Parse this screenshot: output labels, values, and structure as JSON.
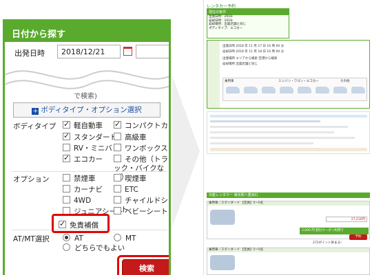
{
  "left_panel": {
    "header": "日付から探す",
    "date_label": "出発日時",
    "date_value": "2018/12/21",
    "cut_text": "で検索)",
    "toggle_label": "ボディタイプ・オプション選択",
    "body_type_label": "ボディタイプ",
    "body_types": [
      {
        "label": "軽自動車",
        "checked": true
      },
      {
        "label": "コンパクトカー",
        "checked": true
      },
      {
        "label": "スタンダード",
        "checked": true
      },
      {
        "label": "高級車",
        "checked": false
      },
      {
        "label": "RV・ミニバン",
        "checked": false
      },
      {
        "label": "ワンボックス",
        "checked": false
      },
      {
        "label": "エコカー",
        "checked": true
      },
      {
        "label": "その他（トラック・バイクなど）",
        "checked": false
      }
    ],
    "option_label": "オプション",
    "options": [
      {
        "label": "禁煙車",
        "checked": false
      },
      {
        "label": "喫煙車",
        "checked": false
      },
      {
        "label": "カーナビ",
        "checked": false
      },
      {
        "label": "ETC",
        "checked": false
      },
      {
        "label": "4WD",
        "checked": false
      },
      {
        "label": "チャイルドシート",
        "checked": false
      },
      {
        "label": "ジュニアシート",
        "checked": false
      },
      {
        "label": "ベビーシート",
        "checked": false
      },
      {
        "label": "免責補償",
        "checked": true
      }
    ],
    "atmt_label": "AT/MT選択",
    "atmt_options": [
      {
        "label": "AT",
        "selected": true
      },
      {
        "label": "MT",
        "selected": false
      },
      {
        "label": "どちらでもよい",
        "selected": false
      }
    ],
    "search_button": "検索"
  },
  "right_page": {
    "logo": "レンタカー予約",
    "cond_title": "現在の条件",
    "cond_lines": [
      "出発日時：2018-",
      "返却日時：2018-",
      "返却場所：出発店舗と同じ",
      "ボディタイプ：エコカー"
    ],
    "search_lines": [
      "出発日時  2018 年 11 月 17 日 10 時 00 分",
      "返却日時  2018 年 11 月 18 日 10 時 00 分",
      "出発場所  エリアから検索  空港から検索",
      "返却場所  出発店舗と同じ"
    ],
    "cars_labels": [
      "乗用車",
      "ミニバン・ワゴン・エコカー",
      "その他"
    ],
    "list_title": "日産レンタカー 東京駅八重洲口",
    "items": [
      {
        "head": "乗用車／スタンダード  【定員】5〜5名",
        "price": "27,216円",
        "button": "予約"
      },
      {
        "head": "乗用車／スタンダード  【定員】5〜5名",
        "price": "2,000 円",
        "button": "予約"
      }
    ],
    "coupon": "2,000 円 割引クーポン利用で",
    "points": "272ポイント貯まる!"
  }
}
